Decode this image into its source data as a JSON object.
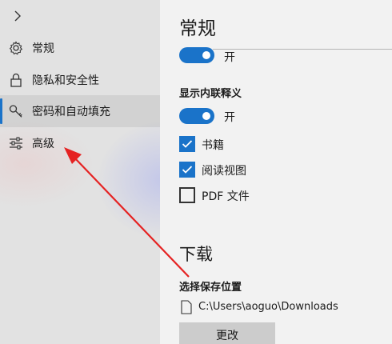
{
  "colors": {
    "accent": "#1a73c9",
    "arrow": "#e52222"
  },
  "sidebar": {
    "items": [
      {
        "label": "常规",
        "icon": "gear-icon"
      },
      {
        "label": "隐私和安全性",
        "icon": "lock-icon"
      },
      {
        "label": "密码和自动填充",
        "icon": "key-icon",
        "selected": true
      },
      {
        "label": "高级",
        "icon": "sliders-icon"
      }
    ]
  },
  "main": {
    "title": "常规",
    "toggle_top": {
      "state": "开",
      "on": true
    },
    "inline_define": {
      "heading": "显示内联释义",
      "toggle": {
        "state": "开",
        "on": true
      },
      "options": [
        {
          "label": "书籍",
          "checked": true
        },
        {
          "label": "阅读视图",
          "checked": true
        },
        {
          "label": "PDF 文件",
          "checked": false
        }
      ]
    },
    "downloads": {
      "title": "下载",
      "location_label": "选择保存位置",
      "path": "C:\\Users\\aoguo\\Downloads",
      "change_button": "更改"
    }
  }
}
